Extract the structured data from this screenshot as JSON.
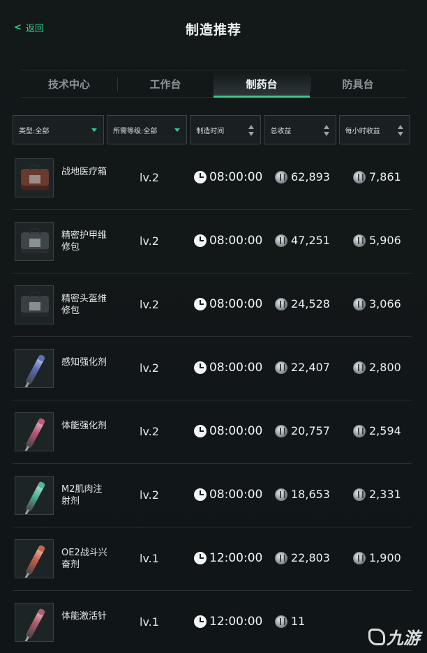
{
  "header": {
    "back_label": "返回",
    "title": "制造推荐"
  },
  "tabs": [
    {
      "label": "技术中心",
      "active": false
    },
    {
      "label": "工作台",
      "active": false
    },
    {
      "label": "制药台",
      "active": true
    },
    {
      "label": "防具台",
      "active": false
    }
  ],
  "filters": {
    "type": "类型:全部",
    "level": "所需等级:全部",
    "time": "制造时间",
    "total": "总收益",
    "hourly": "每小时收益"
  },
  "items": [
    {
      "name": "战地医疗箱",
      "level": "lv.2",
      "time": "08:00:00",
      "total": "62,893",
      "hourly": "7,861",
      "art": "bag",
      "color": "#6b3a2e"
    },
    {
      "name": "精密护甲维修包",
      "level": "lv.2",
      "time": "08:00:00",
      "total": "47,251",
      "hourly": "5,906",
      "art": "bag",
      "color": "#3e4448"
    },
    {
      "name": "精密头盔维修包",
      "level": "lv.2",
      "time": "08:00:00",
      "total": "24,528",
      "hourly": "3,066",
      "art": "bag",
      "color": "#3a3f42"
    },
    {
      "name": "感知强化剂",
      "level": "lv.2",
      "time": "08:00:00",
      "total": "22,407",
      "hourly": "2,800",
      "art": "syringe",
      "color": "#5a6fb8"
    },
    {
      "name": "体能强化剂",
      "level": "lv.2",
      "time": "08:00:00",
      "total": "20,757",
      "hourly": "2,594",
      "art": "syringe",
      "color": "#c0567a"
    },
    {
      "name": "M2肌肉注射剂",
      "level": "lv.2",
      "time": "08:00:00",
      "total": "18,653",
      "hourly": "2,331",
      "art": "syringe",
      "color": "#4fb89c"
    },
    {
      "name": "OE2战斗兴奋剂",
      "level": "lv.1",
      "time": "12:00:00",
      "total": "22,803",
      "hourly": "1,900",
      "art": "syringe",
      "color": "#d0614a"
    },
    {
      "name": "体能激活针",
      "level": "lv.1",
      "time": "12:00:00",
      "total": "11",
      "hourly": "",
      "art": "syringe",
      "color": "#b85a6a"
    }
  ],
  "watermark": "九游"
}
